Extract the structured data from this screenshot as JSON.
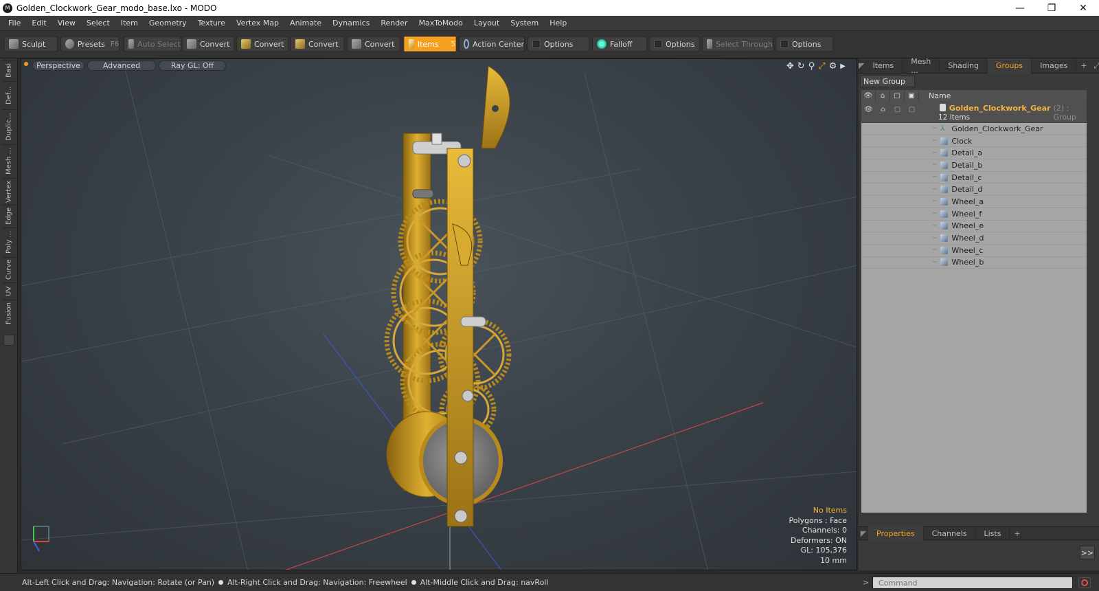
{
  "window": {
    "title": "Golden_Clockwork_Gear_modo_base.lxo - MODO",
    "minimize": "—",
    "maximize": "❐",
    "close": "✕"
  },
  "menu": [
    "File",
    "Edit",
    "View",
    "Select",
    "Item",
    "Geometry",
    "Texture",
    "Vertex Map",
    "Animate",
    "Dynamics",
    "Render",
    "MaxToModo",
    "Layout",
    "System",
    "Help"
  ],
  "toolbar": {
    "sculpt": "Sculpt",
    "presets": "Presets",
    "presets_key": "F6",
    "auto_select": "Auto Select",
    "convert1": "Convert",
    "convert2": "Convert",
    "convert3": "Convert",
    "convert4": "Convert",
    "items": "Items",
    "items_key": "5",
    "action_center": "Action Center",
    "options1": "Options",
    "falloff": "Falloff",
    "options2": "Options",
    "select_through": "Select Through",
    "options3": "Options",
    "accent": "#f5a020"
  },
  "left_tabs": [
    "Basi",
    "Def...",
    "Duplic...",
    "Mesh ...",
    "Vertex",
    "Edge",
    "Poly ...",
    "Curve",
    "UV",
    "Fusion"
  ],
  "viewport": {
    "view_mode": "Perspective",
    "shading": "Advanced",
    "raygl": "Ray GL: Off",
    "info": {
      "selection": "No Items",
      "polygons": "Polygons : Face",
      "channels": "Channels: 0",
      "deformers": "Deformers: ON",
      "gl": "GL: 105,376",
      "scale": "10 mm"
    }
  },
  "right_panel": {
    "tabs": [
      "Items",
      "Mesh ...",
      "Shading",
      "Groups",
      "Images"
    ],
    "active_tab": "Groups",
    "new_group": "New Group",
    "column_name": "Name",
    "group": {
      "name": "Golden_Clockwork_Gear",
      "suffix": "(2) : Group",
      "count": "12 Items"
    },
    "items": [
      {
        "name": "Golden_Clockwork_Gear",
        "icon": "locator-icon"
      },
      {
        "name": "Clock",
        "icon": "mesh-icon"
      },
      {
        "name": "Detail_a",
        "icon": "mesh-icon"
      },
      {
        "name": "Detail_b",
        "icon": "mesh-icon"
      },
      {
        "name": "Detail_c",
        "icon": "mesh-icon"
      },
      {
        "name": "Detail_d",
        "icon": "mesh-icon"
      },
      {
        "name": "Wheel_a",
        "icon": "mesh-icon"
      },
      {
        "name": "Wheel_f",
        "icon": "mesh-icon"
      },
      {
        "name": "Wheel_e",
        "icon": "mesh-icon"
      },
      {
        "name": "Wheel_d",
        "icon": "mesh-icon"
      },
      {
        "name": "Wheel_c",
        "icon": "mesh-icon"
      },
      {
        "name": "Wheel_b",
        "icon": "mesh-icon"
      }
    ],
    "bottom_tabs": [
      "Properties",
      "Channels",
      "Lists"
    ],
    "expand": ">>"
  },
  "status": {
    "hint1": "Alt-Left Click and Drag: Navigation: Rotate (or Pan)",
    "hint2": "Alt-Right Click and Drag: Navigation: Freewheel",
    "hint3": "Alt-Middle Click and Drag: navRoll"
  },
  "command": {
    "prompt": ">",
    "placeholder": "Command"
  }
}
